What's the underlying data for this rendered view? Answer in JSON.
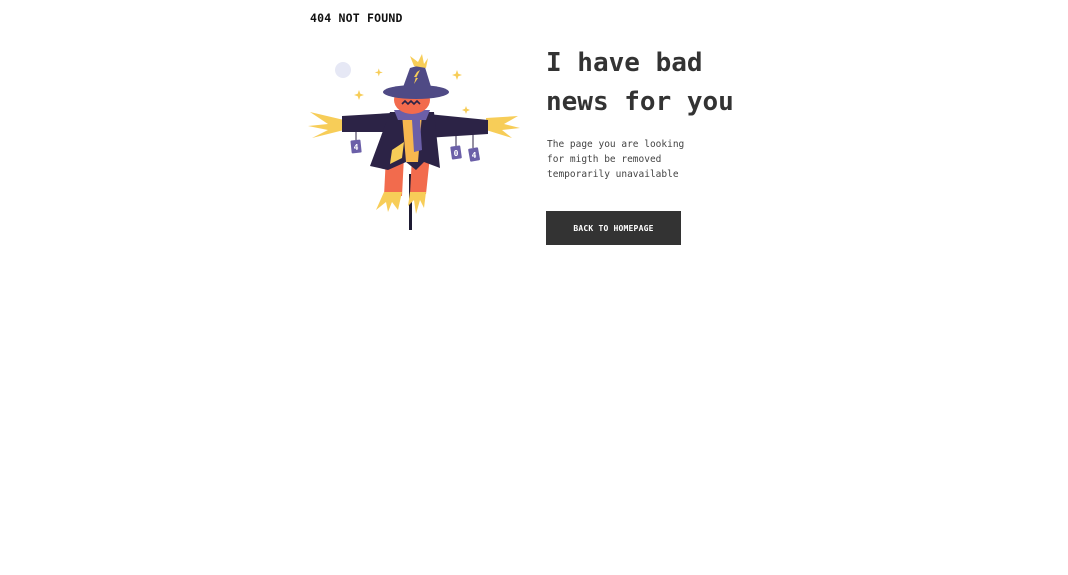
{
  "header": {
    "title": "404 NOT FOUND"
  },
  "illustration": {
    "icon": "scarecrow-illustration",
    "sign_digits": [
      "4",
      "0",
      "4"
    ]
  },
  "main": {
    "headline_lines": [
      "I have bad",
      "news for you"
    ],
    "body_lines": [
      "The page you are looking",
      "for migth be removed",
      "temporarily unavailable"
    ],
    "button_label": "BACK TO HOMEPAGE"
  },
  "colors": {
    "background": "#ffffff",
    "text": "#333333",
    "button_bg": "#333333",
    "button_text": "#ffffff",
    "scarecrow_coat": "#2c2346",
    "scarecrow_hat": "#4f4a85",
    "scarecrow_face": "#f26b4d",
    "straw": "#f7cd58",
    "accent_sparkle": "#f7cd58"
  }
}
